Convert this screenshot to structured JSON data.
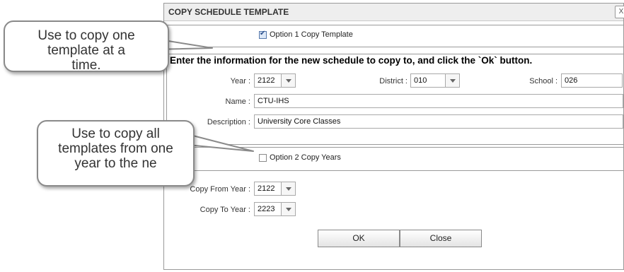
{
  "dialog": {
    "title": "COPY SCHEDULE TEMPLATE",
    "close_label": "X"
  },
  "option1": {
    "checked": true,
    "label": "Option 1 Copy Template"
  },
  "instruction": "Enter the information for the new schedule to copy to, and click the `Ok` button.",
  "form": {
    "year_label": "Year :",
    "year_value": "2122",
    "district_label": "District :",
    "district_value": "010",
    "school_label": "School :",
    "school_value": "026",
    "name_label": "Name :",
    "name_value": "CTU-IHS",
    "description_label": "Description :",
    "description_value": "University Core Classes"
  },
  "option2": {
    "checked": false,
    "label": "Option 2 Copy Years"
  },
  "copy_years": {
    "from_label": "Copy From Year :",
    "from_value": "2122",
    "to_label": "Copy To Year :",
    "to_value": "2223"
  },
  "buttons": {
    "ok": "OK",
    "close": "Close"
  },
  "callouts": {
    "first": "Use to copy one template at a time.",
    "second": "Use to copy all templates from one year to the ne"
  }
}
